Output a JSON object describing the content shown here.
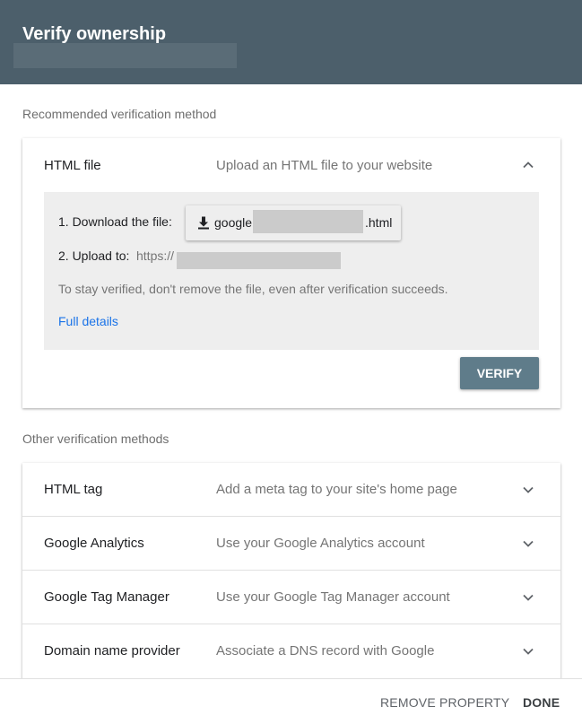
{
  "header": {
    "title": "Verify ownership"
  },
  "recommended": {
    "section_label": "Recommended verification method",
    "method": {
      "name": "HTML file",
      "description": "Upload an HTML file to your website",
      "expand_icon": "chevron-up-icon",
      "step1_label": "1. Download the file:",
      "download_icon": "download-icon",
      "file_prefix": "google",
      "file_suffix": ".html",
      "step2_label": "2. Upload to:",
      "step2_url_prefix": "https://",
      "note": "To stay verified, don't remove the file, even after verification succeeds.",
      "full_details": "Full details",
      "verify_label": "VERIFY"
    }
  },
  "other": {
    "section_label": "Other verification methods",
    "methods": [
      {
        "name": "HTML tag",
        "description": "Add a meta tag to your site's home page"
      },
      {
        "name": "Google Analytics",
        "description": "Use your Google Analytics account"
      },
      {
        "name": "Google Tag Manager",
        "description": "Use your Google Tag Manager account"
      },
      {
        "name": "Domain name provider",
        "description": "Associate a DNS record with Google"
      }
    ]
  },
  "footer": {
    "remove_label": "REMOVE PROPERTY",
    "done_label": "DONE"
  },
  "colors": {
    "header_bg": "#4c5f6b",
    "verify_bg": "#5f7c8a",
    "link": "#1a73e8"
  }
}
